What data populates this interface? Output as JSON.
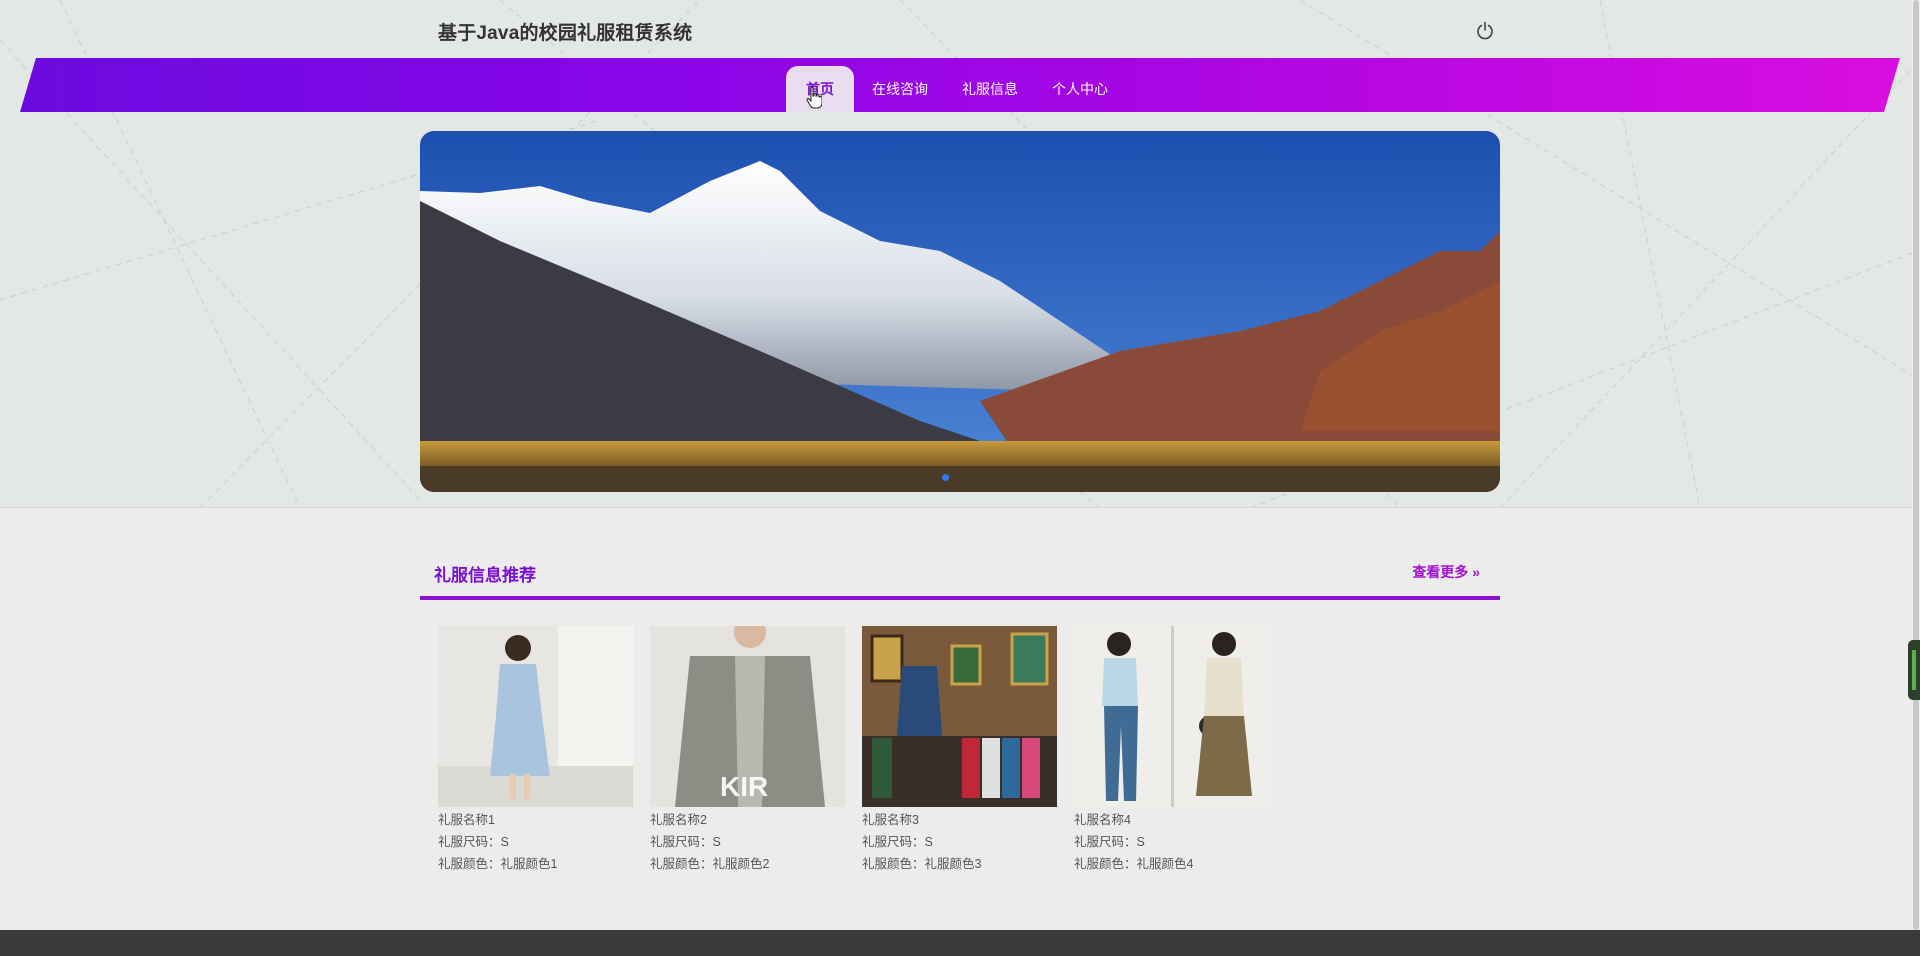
{
  "header": {
    "title": "基于Java的校园礼服租赁系统",
    "power_icon": "power-icon"
  },
  "nav": {
    "items": [
      {
        "label": "首页",
        "active": true
      },
      {
        "label": "在线咨询",
        "active": false
      },
      {
        "label": "礼服信息",
        "active": false
      },
      {
        "label": "个人中心",
        "active": false
      }
    ]
  },
  "banner": {
    "image": "snow-mountain-landscape",
    "slide_count": 1,
    "current_slide": 1
  },
  "section": {
    "title": "礼服信息推荐",
    "more_label": "查看更多",
    "more_icon": "double-chevron-right-icon"
  },
  "items": [
    {
      "name": "礼服名称1",
      "size": "礼服尺码：S",
      "color": "礼服颜色：礼服颜色1",
      "image": "light-blue-dress-photo"
    },
    {
      "name": "礼服名称2",
      "size": "礼服尺码：S",
      "color": "礼服颜色：礼服颜色2",
      "image": "grey-jacket-photo",
      "logo_text": "KIR"
    },
    {
      "name": "礼服名称3",
      "size": "礼服尺码：S",
      "color": "礼服颜色：礼服颜色3",
      "image": "clothing-store-photo"
    },
    {
      "name": "礼服名称4",
      "size": "礼服尺码：S",
      "color": "礼服颜色：礼服颜色4",
      "image": "two-women-outfits-photo"
    }
  ],
  "colors": {
    "accent": "#8c0fd6",
    "nav_gradient_start": "#6b0be0",
    "nav_gradient_end": "#d90de0",
    "carousel_dot": "#2d7bf0"
  }
}
